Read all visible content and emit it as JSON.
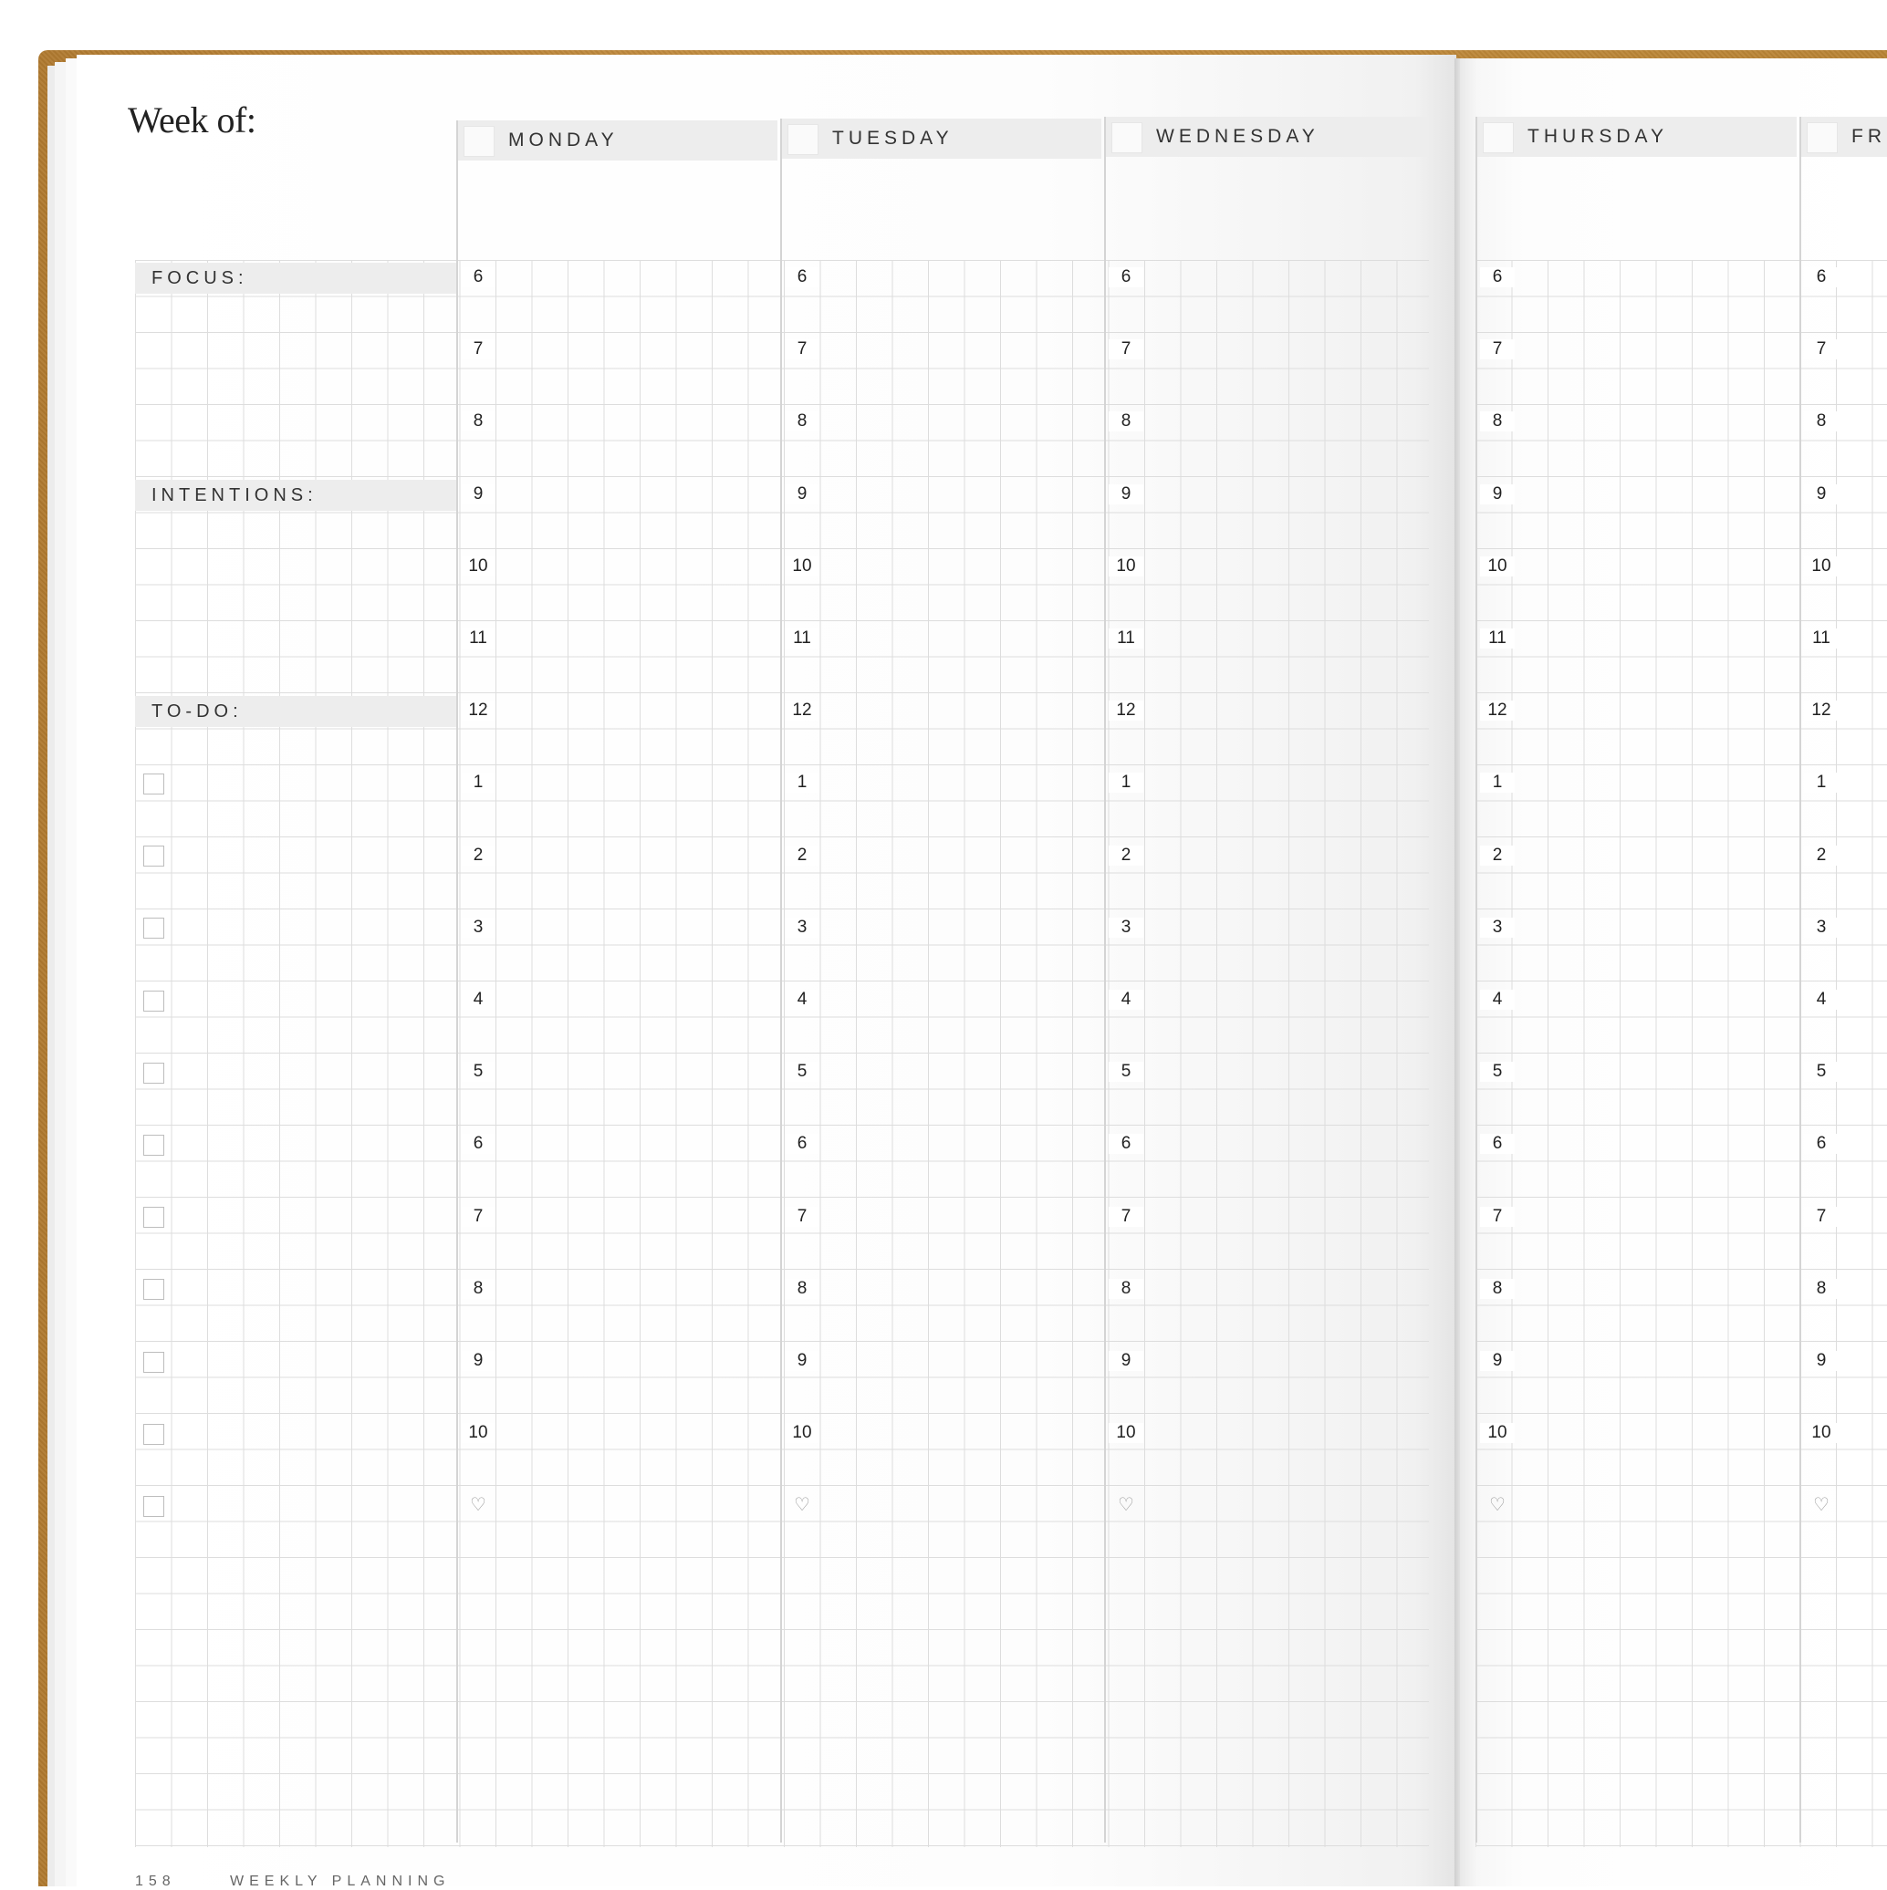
{
  "heading": "Week of:",
  "sections": {
    "focus": "FOCUS:",
    "intentions": "INTENTIONS:",
    "todo": "TO-DO:"
  },
  "days": [
    "MONDAY",
    "TUESDAY",
    "WEDNESDAY",
    "THURSDAY",
    "FR"
  ],
  "hours": [
    "6",
    "7",
    "8",
    "9",
    "10",
    "11",
    "12",
    "1",
    "2",
    "3",
    "4",
    "5",
    "6",
    "7",
    "8",
    "9",
    "10"
  ],
  "todo_checkbox_count": 11,
  "footer": {
    "page_number": "158",
    "section": "WEEKLY PLANNING"
  },
  "icons": [
    "heart-icon",
    "checkbox-icon"
  ],
  "colors": {
    "cover": "#b98435",
    "label_background": "#ededed",
    "grid_line": "#dddddd"
  }
}
